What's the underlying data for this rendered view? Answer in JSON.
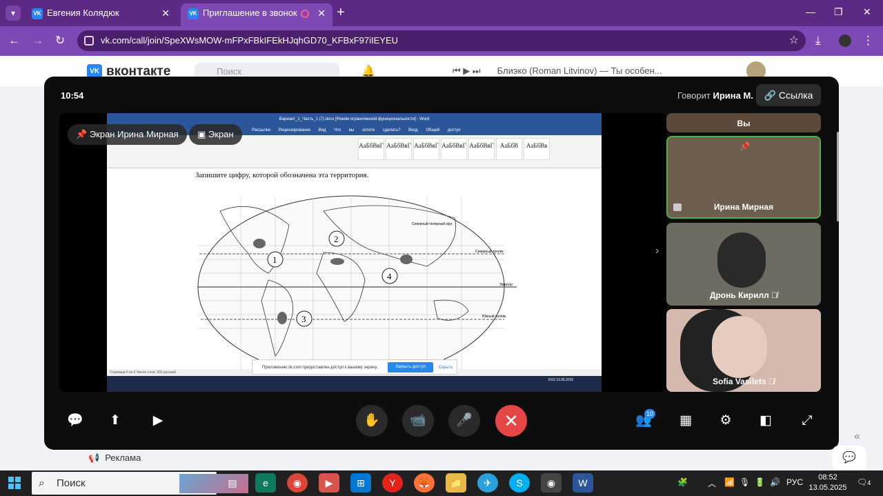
{
  "browser": {
    "tabs": [
      {
        "title": "Евгения Колядюк"
      },
      {
        "title": "Приглашение в звонок"
      }
    ],
    "url": "vk.com/call/join/SpeXWsMOW-mFPxFBkIFEkHJqhGD70_KFBxF97iIEYEU"
  },
  "vk": {
    "logo_text": "вконтакте",
    "search_placeholder": "Поиск",
    "now_playing": "Блиэко (Roman Litvinov) — Ты особен...",
    "ads_label": "Реклама"
  },
  "call": {
    "time": "10:54",
    "speaking_prefix": "Говорит",
    "speaking_name": "Ирина М.",
    "link_label": "Ссылка",
    "screen_pill_pinned": "Экран Ирина Мирная",
    "screen_pill": "Экран",
    "participants": [
      {
        "name": "Вы",
        "muted": false
      },
      {
        "name": "Ирина Мирная",
        "muted": false
      },
      {
        "name": "Дронь Кирилл",
        "muted": true
      },
      {
        "name": "Sofia Vasilets",
        "muted": true
      }
    ],
    "participants_count": "10"
  },
  "shared_screen": {
    "word_title": "Вариант_1_Часть_1 (7).docx [Режим ограниченной функциональности] - Word",
    "ribbon_tabs": "Рассылки Рецензирование Вид Что вы хотите сделать? Вход Общий доступ",
    "styles": [
      "АаБбВвГ",
      "АаБбВвГ",
      "АаБбВвГ",
      "АаБбВвГ",
      "АаБбВвГ",
      "АаБбВ",
      "АаБбВв"
    ],
    "doc_line": "Запишите цифру, которой обозначена эта территория.",
    "map_labels": [
      "Северный полярный круг",
      "Северный тропик",
      "Экватор",
      "Южный тропик"
    ],
    "map_markers": [
      "1",
      "2",
      "3",
      "4"
    ],
    "status": "Страница 5 из 6   Число слов: 932   русский",
    "notification": "Приложению vk.com предоставлен доступ к вашему экрану.",
    "notification_btn": "Закрыть доступ",
    "notification_hide": "Скрыть",
    "inner_clock": "8:53 13.05.2025"
  },
  "taskbar": {
    "search_label": "Поиск",
    "lang": "РУС",
    "time": "08:52",
    "date": "13.05.2025",
    "notif_count": "4"
  },
  "colors": {
    "accent": "#2688eb",
    "end_call": "#e64646",
    "browser_bar": "#7d49b5"
  }
}
